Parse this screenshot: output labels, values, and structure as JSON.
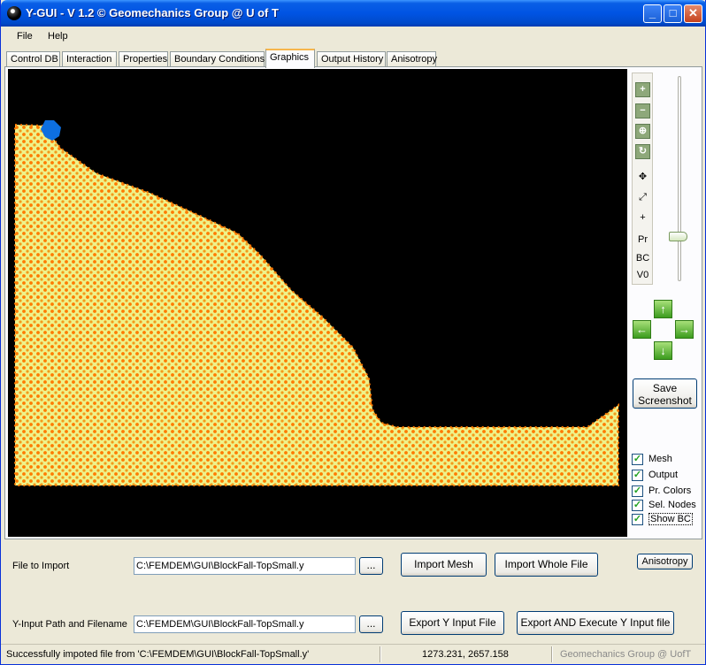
{
  "window": {
    "title": "Y-GUI - V 1.2 © Geomechanics Group @ U of T"
  },
  "menu": {
    "file": "File",
    "help": "Help"
  },
  "tabs": [
    "Control DB",
    "Interaction",
    "Properties",
    "Boundary Conditions",
    "Graphics",
    "Output History",
    "Anisotropy"
  ],
  "active_tab": "Graphics",
  "toolbar": {
    "items": [
      "zoom-in-icon",
      "zoom-out-icon",
      "zoom-fit-icon",
      "zoom-reset-icon",
      "pan-icon",
      "expand-icon",
      "plus-icon"
    ],
    "text_items": [
      "Pr",
      "BC",
      "V0"
    ]
  },
  "zoom_slider": {
    "value": 0.2
  },
  "buttons": {
    "save_screenshot": "Save Screenshot",
    "import_mesh": "Import Mesh",
    "import_whole_file": "Import Whole File",
    "anisotropy": "Anisotropy",
    "export_y_input": "Export Y Input File",
    "export_execute": "Export AND Execute Y Input file",
    "browse": "..."
  },
  "checkboxes": [
    {
      "label": "Mesh",
      "checked": true
    },
    {
      "label": "Output",
      "checked": true
    },
    {
      "label": "Pr. Colors",
      "checked": true
    },
    {
      "label": "Sel. Nodes",
      "checked": true
    },
    {
      "label": "Show BC",
      "checked": true
    }
  ],
  "fields": {
    "file_to_import_label": "File to Import",
    "file_to_import_value": "C:\\FEMDEM\\GUI\\BlockFall-TopSmall.y",
    "y_input_label": "Y-Input Path and Filename",
    "y_input_value": "C:\\FEMDEM\\GUI\\BlockFall-TopSmall.y"
  },
  "status": {
    "message": "Successfully impoted file from 'C:\\FEMDEM\\GUI\\BlockFall-TopSmall.y'",
    "coords": "1273.231, 2657.158",
    "credit": "Geomechanics Group @ UofT"
  },
  "colors": {
    "mesh_fill": "#f2ee7a",
    "node": "#ff7a00",
    "block": "#0d6fe0",
    "canvas": "#000000"
  }
}
